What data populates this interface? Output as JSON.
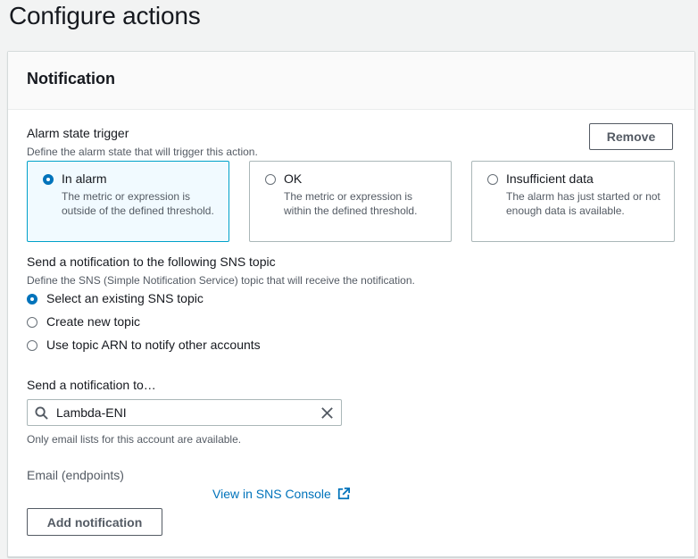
{
  "page": {
    "title": "Configure actions"
  },
  "notification": {
    "header": "Notification",
    "remove_label": "Remove",
    "trigger": {
      "label": "Alarm state trigger",
      "description": "Define the alarm state that will trigger this action.",
      "options": [
        {
          "title": "In alarm",
          "description": "The metric or expression is outside of the defined threshold.",
          "selected": true
        },
        {
          "title": "OK",
          "description": "The metric or expression is within the defined threshold.",
          "selected": false
        },
        {
          "title": "Insufficient data",
          "description": "The alarm has just started or not enough data is available.",
          "selected": false
        }
      ]
    },
    "sns": {
      "label": "Send a notification to the following SNS topic",
      "description": "Define the SNS (Simple Notification Service) topic that will receive the notification.",
      "options": [
        {
          "label": "Select an existing SNS topic",
          "selected": true
        },
        {
          "label": "Create new topic",
          "selected": false
        },
        {
          "label": "Use topic ARN to notify other accounts",
          "selected": false
        }
      ]
    },
    "send_to": {
      "label": "Send a notification to…",
      "value": "Lambda-ENI",
      "hint": "Only email lists for this account are available."
    },
    "email": {
      "label": "Email (endpoints)",
      "link_label": "View in SNS Console"
    },
    "add_label": "Add notification"
  },
  "colors": {
    "accent": "#0073bb",
    "selected_border": "#00a1c9",
    "selected_bg": "#f1faff"
  }
}
